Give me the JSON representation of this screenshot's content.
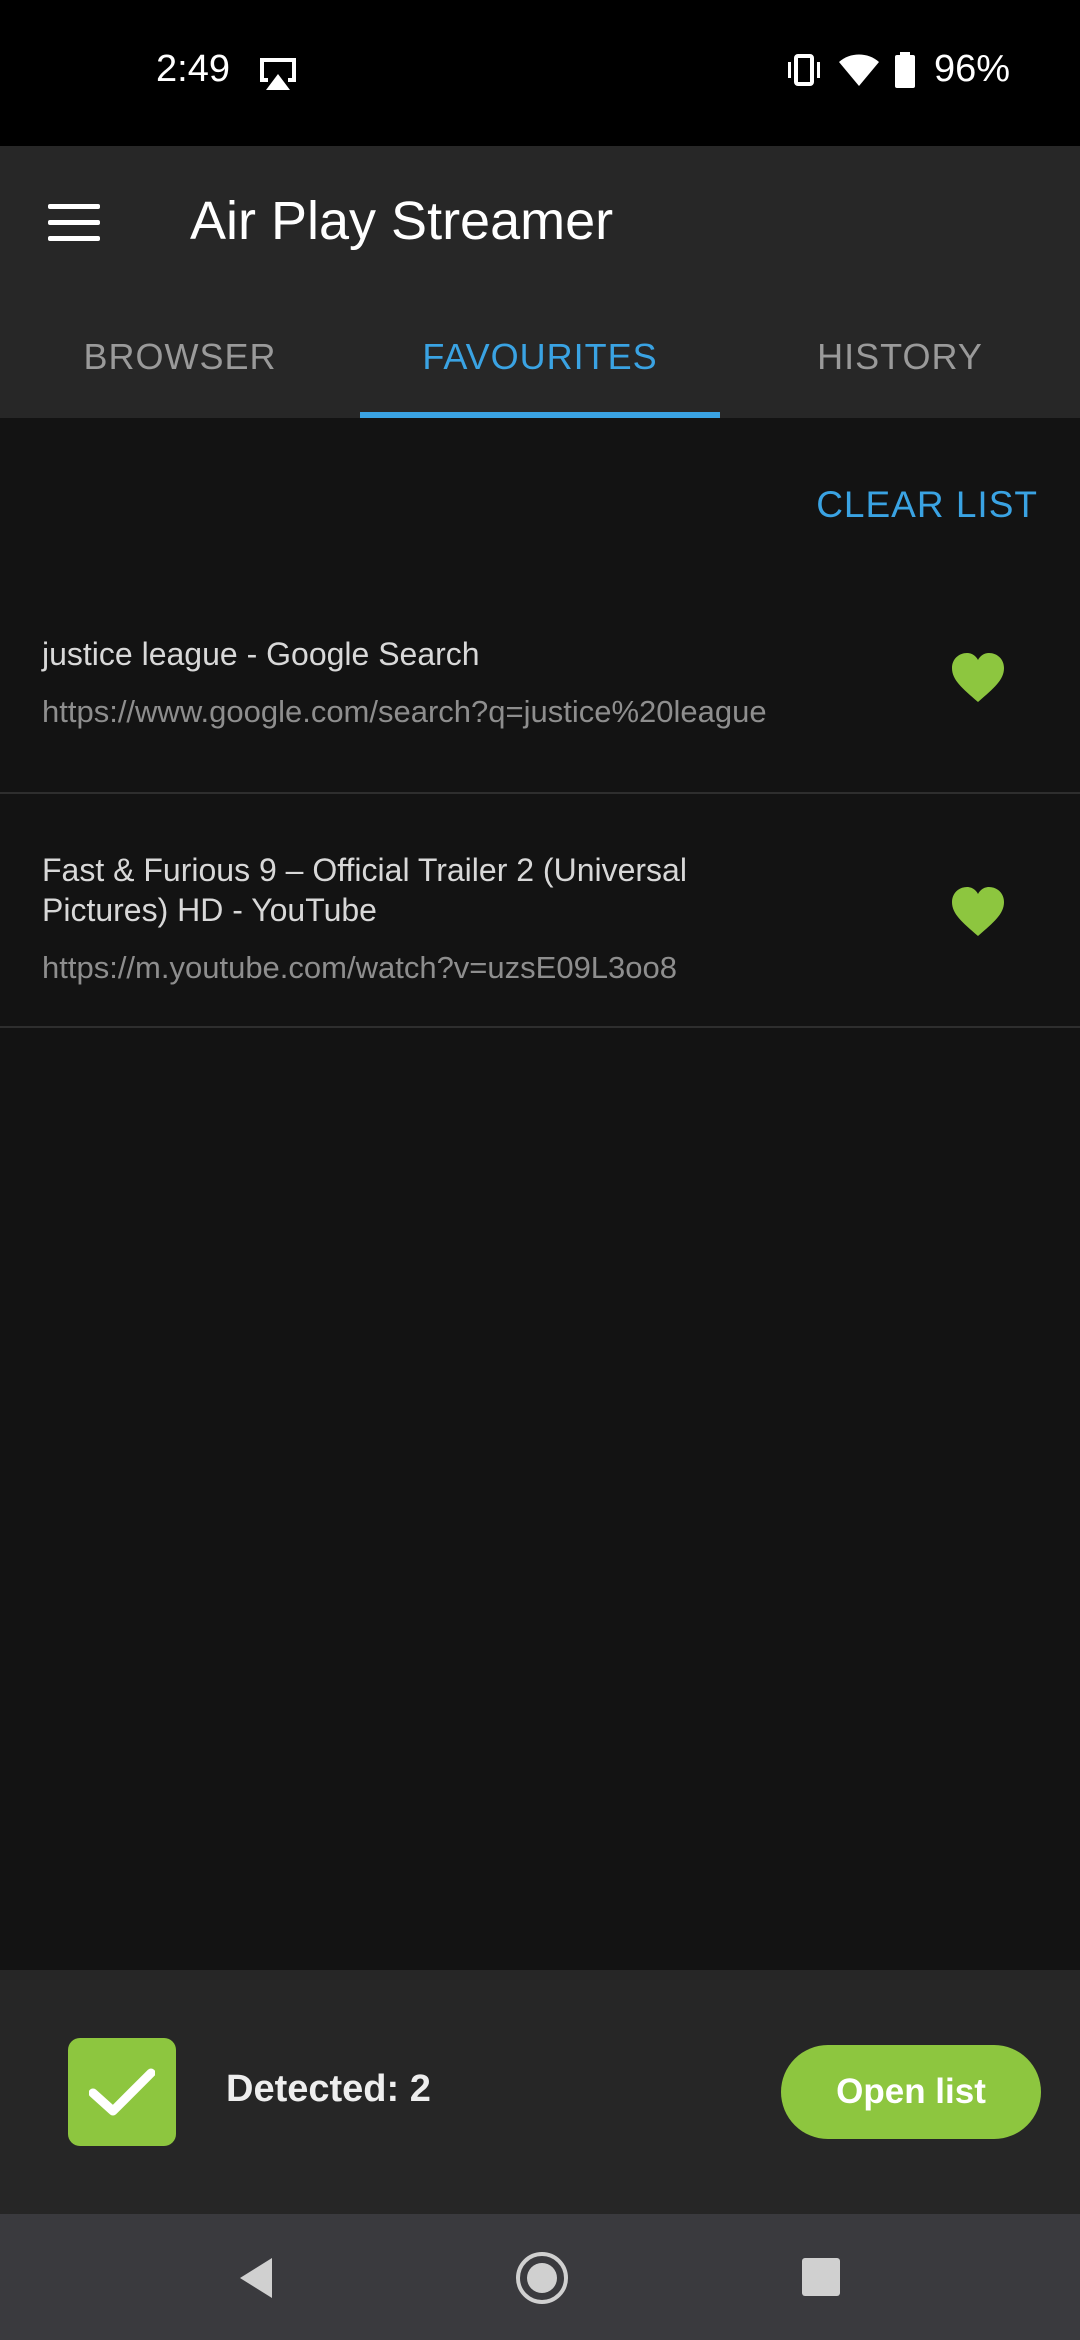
{
  "status_bar": {
    "time": "2:49",
    "battery": "96%"
  },
  "app": {
    "title": "Air Play Streamer"
  },
  "tabs": [
    {
      "label": "BROWSER",
      "active": false
    },
    {
      "label": "FAVOURITES",
      "active": true
    },
    {
      "label": "HISTORY",
      "active": false
    }
  ],
  "actions": {
    "clear_list": "CLEAR LIST"
  },
  "favourites": [
    {
      "title": "justice league - Google Search",
      "url": "https://www.google.com/search?q=justice%20league",
      "icon": "heart-icon"
    },
    {
      "title": "Fast & Furious 9 – Official Trailer 2 (Universal Pictures) HD - YouTube",
      "url": "https://m.youtube.com/watch?v=uzsE09L3oo8",
      "icon": "heart-icon"
    }
  ],
  "bottom_bar": {
    "detected": "Detected: 2",
    "open_list": "Open list"
  },
  "colors": {
    "accent": "#3aa3e3",
    "green": "#8dc63f",
    "background": "#131313",
    "appbar": "#272727"
  }
}
